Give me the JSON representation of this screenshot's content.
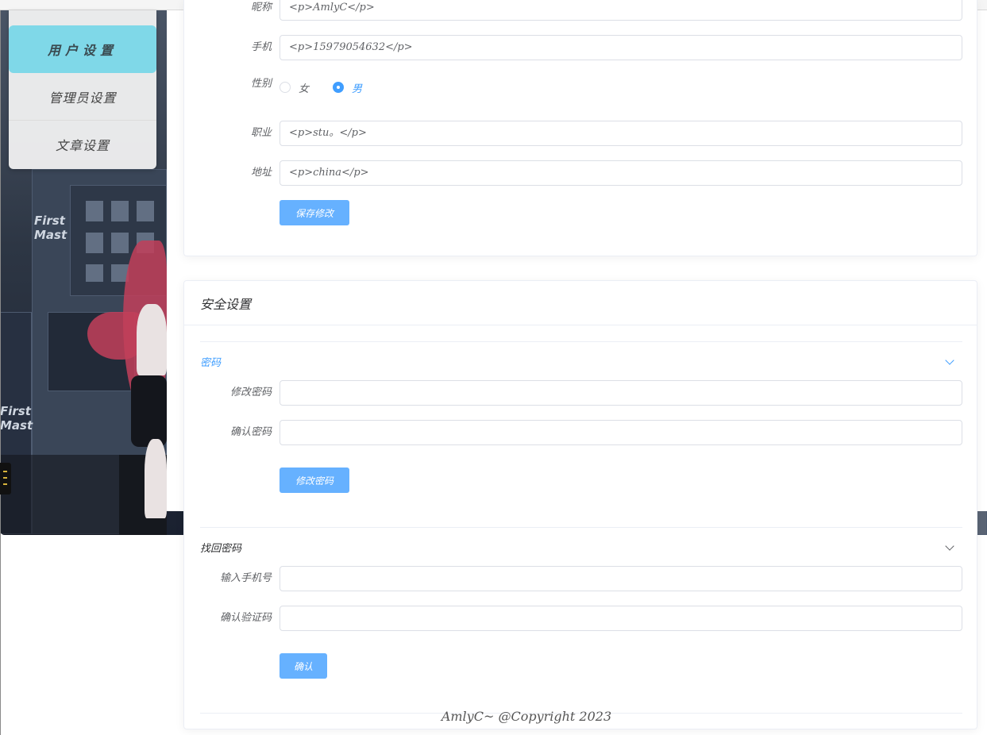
{
  "menu": {
    "items": [
      {
        "label": "用户设置"
      },
      {
        "label": "管理员设置"
      },
      {
        "label": "文章设置"
      }
    ]
  },
  "profile": {
    "name_label": "昵称",
    "name_value": "<p>AmlyC</p>",
    "phone_label": "手机",
    "phone_value": "<p>15979054632</p>",
    "gender_label": "性别",
    "gender_options": [
      {
        "label": "女",
        "selected": false
      },
      {
        "label": "男",
        "selected": true
      }
    ],
    "job_label": "职业",
    "job_value": "<p>stu。</p>",
    "address_label": "地址",
    "address_value": "<p>china</p>",
    "save_button": "保存修改"
  },
  "security": {
    "title": "安全设置",
    "password_section": {
      "title": "密码",
      "expanded": true,
      "new_label": "修改密码",
      "new_value": "",
      "confirm_label": "确认密码",
      "confirm_value": "",
      "button": "修改密码"
    },
    "recover_section": {
      "title": "找回密码",
      "expanded": true,
      "phone_label": "输入手机号",
      "phone_value": "",
      "code_label": "确认验证码",
      "code_value": "",
      "button": "确认"
    }
  },
  "footer": {
    "text": "AmlyC~ @Copyright 2023"
  },
  "colors": {
    "primary": "#409eff",
    "button": "#66b1ff",
    "menu_active": "#7fd8e8"
  }
}
